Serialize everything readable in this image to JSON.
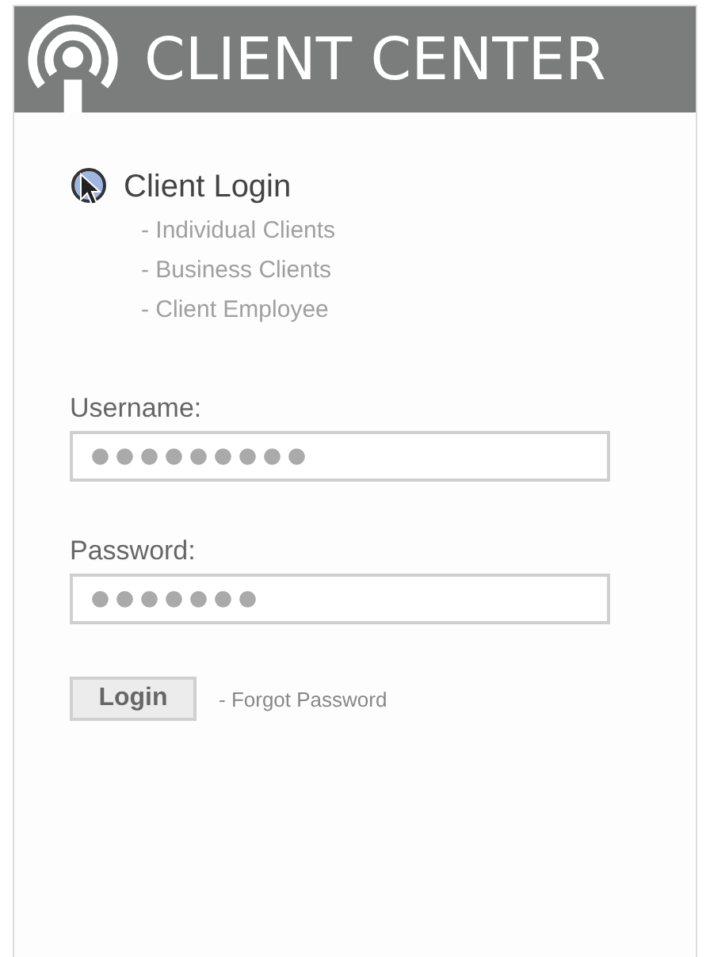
{
  "header": {
    "title": "CLIENT CENTER"
  },
  "login_section": {
    "title": "Client Login",
    "links": [
      "- Individual Clients",
      "- Business Clients",
      "- Client Employee"
    ]
  },
  "fields": [
    {
      "label": "Username:",
      "value": "●●●●●●●●●"
    },
    {
      "label": "Password:",
      "value": "●●●●●●●"
    }
  ],
  "login_button": "Login",
  "forgot_link": "- Forgot Password"
}
